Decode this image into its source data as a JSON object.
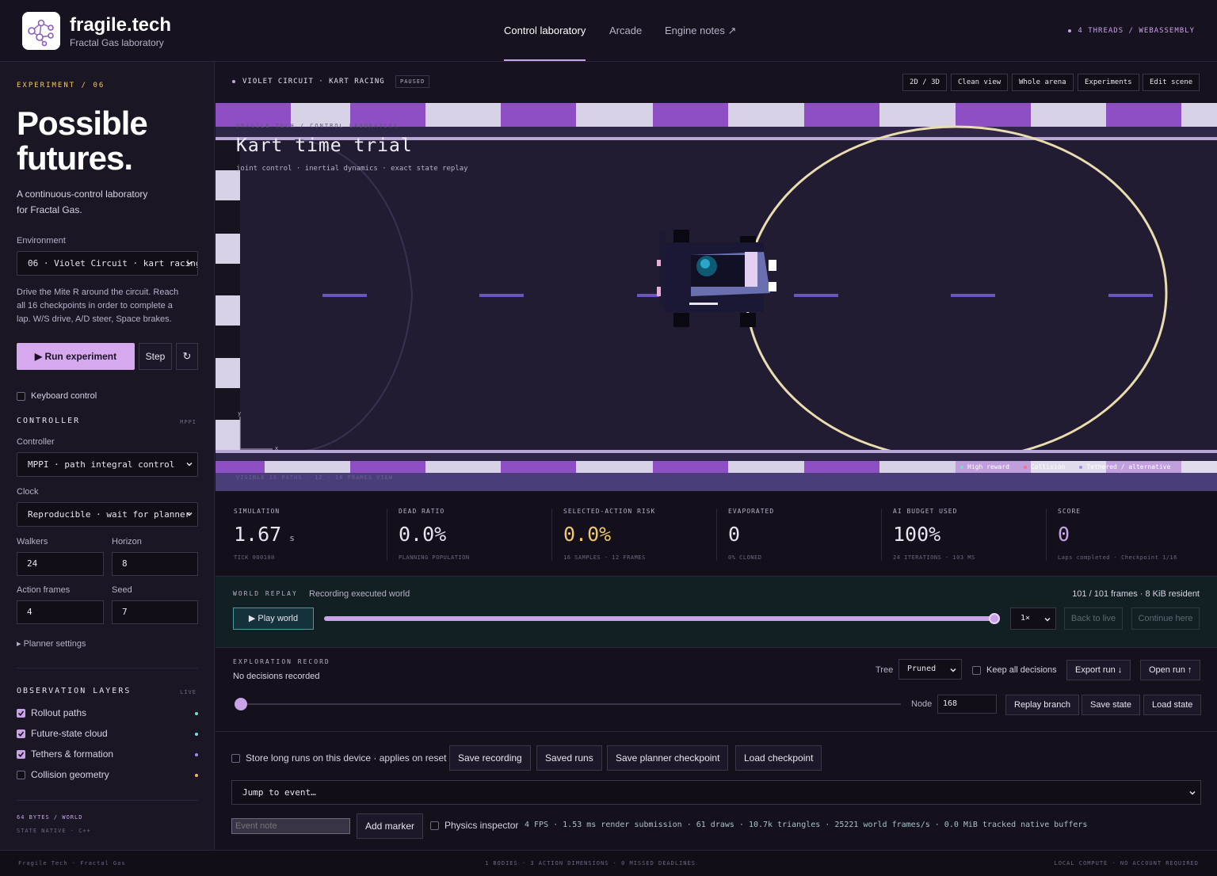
{
  "header": {
    "brand": "fragile.tech",
    "brand_sub": "Fractal Gas laboratory",
    "nav": [
      "Control laboratory",
      "Arcade",
      "Engine notes ↗"
    ],
    "status": "4 THREADS / WEBASSEMBLY"
  },
  "sidebar": {
    "experiment_label": "EXPERIMENT / 06",
    "title_line1": "Possible",
    "title_line2": "futures.",
    "intro_line1": "A continuous-control laboratory",
    "intro_line2": "for Fractal Gas.",
    "environment_label": "Environment",
    "environment_value": "06 · Violet Circuit · kart racing",
    "description_line1": "Drive the Mite R around the circuit. Reach",
    "description_line2": "all 16 checkpoints in order to complete a",
    "description_line3": "lap. W/S drive, A/D steer, Space brakes.",
    "run_label": "▶ Run experiment",
    "step_label": "Step",
    "reset_icon": "↻",
    "keyboard_label": "Keyboard control",
    "controller_heading": "CONTROLLER",
    "controller_tag": "MPPI",
    "controller_label": "Controller",
    "controller_value": "MPPI · path integral control",
    "clock_label": "Clock",
    "clock_value": "Reproducible · wait for planner",
    "walkers_label": "Walkers",
    "walkers_value": "24",
    "horizon_label": "Horizon",
    "horizon_value": "8",
    "action_frames_label": "Action frames",
    "action_frames_value": "4",
    "seed_label": "Seed",
    "seed_value": "7",
    "planner_settings": "▸ Planner settings",
    "obs_heading": "OBSERVATION LAYERS",
    "obs_tag": "LIVE",
    "layers": [
      {
        "label": "Rollout paths",
        "on": true,
        "color": "#6fe3c2"
      },
      {
        "label": "Future-state cloud",
        "on": true,
        "color": "#6fe3e8"
      },
      {
        "label": "Tethers & formation",
        "on": true,
        "color": "#a18cf0"
      },
      {
        "label": "Collision geometry",
        "on": false,
        "color": "#f2b552"
      }
    ],
    "footer_line1": "64 BYTES / WORLD",
    "footer_line2": "STATE NATIVE · C++"
  },
  "stage": {
    "title": "VIOLET CIRCUIT · KART RACING",
    "badge": "PAUSED",
    "buttons": [
      "2D / 3D",
      "Clean view",
      "Whole arena",
      "Experiments",
      "Edit scene"
    ],
    "overlay_crumb": "FRAGILE TECH / CONTROL LABORATORY",
    "overlay_title": "Kart time trial",
    "overlay_sub": "joint control · inertial dynamics · exact state replay",
    "axis_x": "x",
    "axis_y": "y",
    "bottom_note": "VISIBLE 16 PATHS · 12 · 16 FRAMES VIEW",
    "legend": [
      {
        "label": "High reward",
        "color": "#6fe3c2"
      },
      {
        "label": "Collision",
        "color": "#ff6b8a"
      },
      {
        "label": "Tethered / alternative",
        "color": "#a18cf0"
      }
    ]
  },
  "stats": [
    {
      "key": "SIMULATION",
      "value": "1.67",
      "unit": "s",
      "sub": "TICK 000100",
      "color": "#e8e4ee"
    },
    {
      "key": "DEAD RATIO",
      "value": "0.0%",
      "unit": "",
      "sub": "PLANNING POPULATION",
      "color": "#e8e4ee"
    },
    {
      "key": "SELECTED-ACTION RISK",
      "value": "0.0%",
      "unit": "",
      "sub": "16 SAMPLES · 12 FRAMES",
      "color": "#f2c76a"
    },
    {
      "key": "EVAPORATED",
      "value": "0",
      "unit": "",
      "sub": "0% CLONED",
      "color": "#e8e4ee"
    },
    {
      "key": "AI BUDGET USED",
      "value": "100%",
      "unit": "",
      "sub": "24 ITERATIONS · 103 MS",
      "color": "#e8e4ee"
    },
    {
      "key": "SCORE",
      "value": "0",
      "unit": "",
      "sub": "Laps completed · Checkpoint 1/16",
      "color": "#c9a2e8"
    }
  ],
  "replay": {
    "heading": "WORLD REPLAY",
    "status": "Recording executed world",
    "frames": "101 / 101 frames · 8 KiB resident",
    "play_label": "▶ Play world",
    "position": 1.0,
    "speed": "1×",
    "back_label": "Back to live",
    "continue_label": "Continue here"
  },
  "explore": {
    "heading": "EXPLORATION RECORD",
    "status": "No decisions recorded",
    "tree_label": "Tree",
    "tree_value": "Pruned",
    "keep_label": "Keep all decisions",
    "export_label": "Export run ↓",
    "open_label": "Open run ↑",
    "node_label": "Node",
    "node_value": "168",
    "position": 0.0,
    "replay_branch": "Replay branch",
    "save_state": "Save state",
    "load_state": "Load state"
  },
  "bottom": {
    "store_label": "Store long runs on this device · applies on reset",
    "save_recording": "Save recording",
    "saved_runs": "Saved runs",
    "save_checkpoint": "Save planner checkpoint",
    "load_checkpoint": "Load checkpoint",
    "jump_value": "Jump to event…",
    "note_placeholder": "Event note",
    "add_marker": "Add marker",
    "inspector_label": "Physics inspector",
    "perf": "4 FPS · 1.53 ms render submission · 61 draws · 10.7k triangles · 25221 world frames/s · 0.0 MiB tracked native buffers"
  },
  "footer": {
    "left": "Fragile Tech · Fractal Gas",
    "center": "1 BODIES · 3 ACTION DIMENSIONS · 0 MISSED DEADLINES",
    "right": "LOCAL COMPUTE · NO ACCOUNT REQUIRED"
  }
}
